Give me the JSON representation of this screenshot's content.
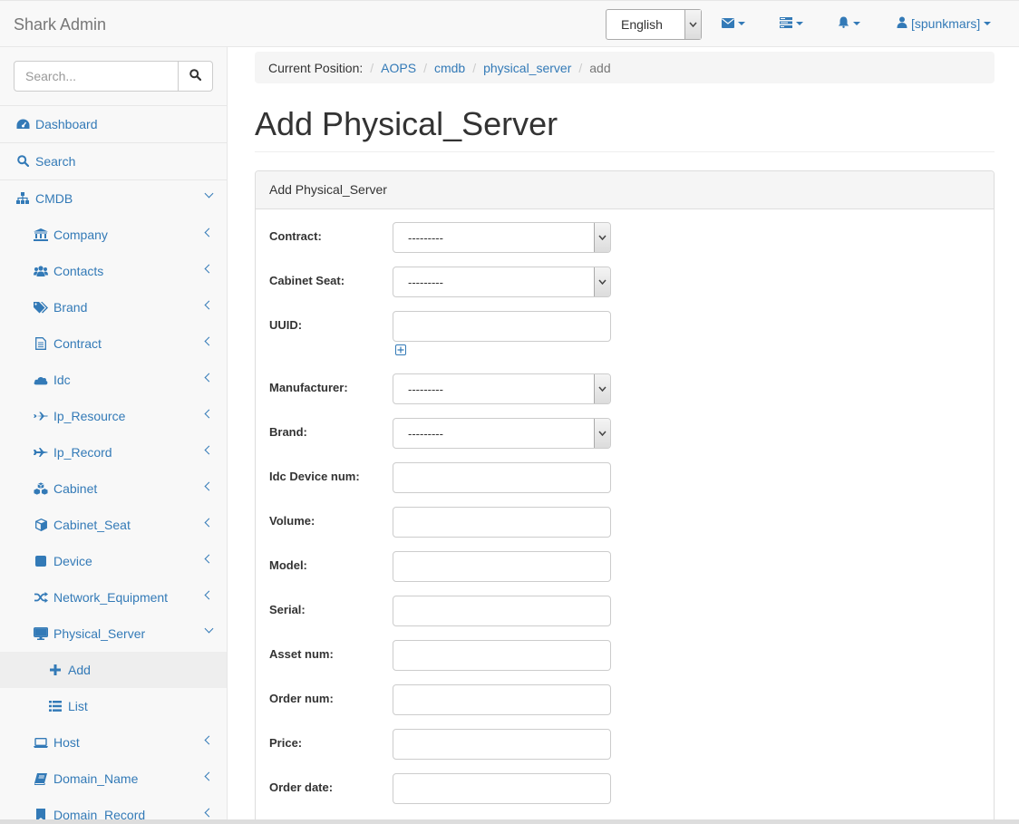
{
  "app": {
    "brand": "Shark Admin"
  },
  "navbar": {
    "language": "English",
    "user": "[spunkmars]"
  },
  "sidebar": {
    "search_placeholder": "Search...",
    "items": [
      {
        "label": "Dashboard",
        "icon": "dashboard-icon"
      },
      {
        "label": "Search",
        "icon": "search-icon"
      },
      {
        "label": "CMDB",
        "icon": "sitemap-icon"
      },
      {
        "label": "Company",
        "icon": "bank-icon"
      },
      {
        "label": "Contacts",
        "icon": "users-icon"
      },
      {
        "label": "Brand",
        "icon": "tags-icon"
      },
      {
        "label": "Contract",
        "icon": "file-text-icon"
      },
      {
        "label": "Idc",
        "icon": "cloud-icon"
      },
      {
        "label": "Ip_Resource",
        "icon": "plane-icon"
      },
      {
        "label": "Ip_Record",
        "icon": "fighter-jet-icon"
      },
      {
        "label": "Cabinet",
        "icon": "cubes-icon"
      },
      {
        "label": "Cabinet_Seat",
        "icon": "cube-icon"
      },
      {
        "label": "Device",
        "icon": "stop-icon"
      },
      {
        "label": "Network_Equipment",
        "icon": "random-icon"
      },
      {
        "label": "Physical_Server",
        "icon": "desktop-icon"
      },
      {
        "label": "Add",
        "icon": "plus-icon"
      },
      {
        "label": "List",
        "icon": "list-icon"
      },
      {
        "label": "Host",
        "icon": "laptop-icon"
      },
      {
        "label": "Domain_Name",
        "icon": "book-icon"
      },
      {
        "label": "Domain_Record",
        "icon": "bookmark-icon"
      }
    ]
  },
  "breadcrumb": {
    "prefix": "Current Position:",
    "links": [
      "AOPS",
      "cmdb",
      "physical_server"
    ],
    "current": "add"
  },
  "page": {
    "title": "Add Physical_Server",
    "panel_title": "Add Physical_Server"
  },
  "form": {
    "fields": [
      {
        "label": "Contract:",
        "type": "select",
        "value": "---------"
      },
      {
        "label": "Cabinet Seat:",
        "type": "select",
        "value": "---------"
      },
      {
        "label": "UUID:",
        "type": "text",
        "value": ""
      },
      {
        "label": "Manufacturer:",
        "type": "select",
        "value": "---------"
      },
      {
        "label": "Brand:",
        "type": "select",
        "value": "---------"
      },
      {
        "label": "Idc Device num:",
        "type": "text",
        "value": ""
      },
      {
        "label": "Volume:",
        "type": "text",
        "value": ""
      },
      {
        "label": "Model:",
        "type": "text",
        "value": ""
      },
      {
        "label": "Serial:",
        "type": "text",
        "value": ""
      },
      {
        "label": "Asset num:",
        "type": "text",
        "value": ""
      },
      {
        "label": "Order num:",
        "type": "text",
        "value": ""
      },
      {
        "label": "Price:",
        "type": "text",
        "value": ""
      },
      {
        "label": "Order date:",
        "type": "text",
        "value": ""
      }
    ]
  },
  "colors": {
    "link": "#337ab7",
    "sidebar_bg": "#f8f8f8",
    "active_bg": "#eeeeee"
  }
}
